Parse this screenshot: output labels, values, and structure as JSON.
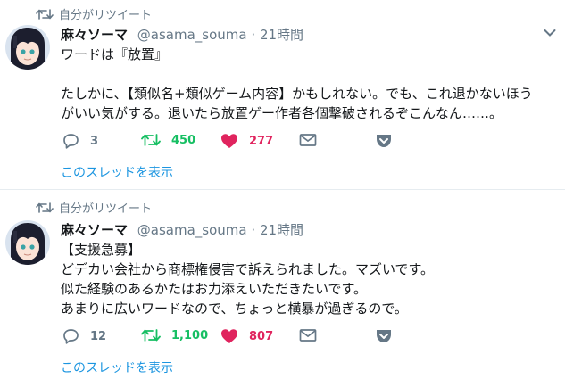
{
  "tweets": [
    {
      "retweet_label": "自分がリツイート",
      "name": "麻々ソーマ",
      "handle": "@asama_souma",
      "dot": "·",
      "time": "21時間",
      "lines": [
        "ワードは『放置』",
        "",
        "たしかに、【類似名+類似ゲーム内容】かもしれない。でも、これ退かないほう",
        "がいい気がする。退いたら放置ゲー作者各個撃破されるぞこんなん……。"
      ],
      "reply_count": "3",
      "retweet_count": "450",
      "like_count": "277",
      "thread_link": "このスレッドを表示"
    },
    {
      "retweet_label": "自分がリツイート",
      "name": "麻々ソーマ",
      "handle": "@asama_souma",
      "dot": "·",
      "time": "21時間",
      "lines": [
        "【支援急募】",
        "どデカい会社から商標権侵害で訴えられました。マズいです。",
        "似た経験のあるかたはお力添えいただきたいです。",
        "あまりに広いワードなので、ちょっと横暴が過ぎるので。"
      ],
      "reply_count": "12",
      "retweet_count": "1,100",
      "like_count": "807",
      "thread_link": "このスレッドを表示"
    }
  ],
  "icons": {
    "retweeted": "retweet-icon",
    "caret": "chevron-down-icon",
    "reply": "reply-icon",
    "retweet": "retweet-icon",
    "like": "heart-icon",
    "dm": "envelope-icon",
    "bookmark": "pocket-icon"
  },
  "colors": {
    "text": "#14171a",
    "muted": "#657786",
    "link": "#1b95e0",
    "retweet_active": "#17bf63",
    "like_active": "#e0245e",
    "divider": "#e6ecf0"
  }
}
